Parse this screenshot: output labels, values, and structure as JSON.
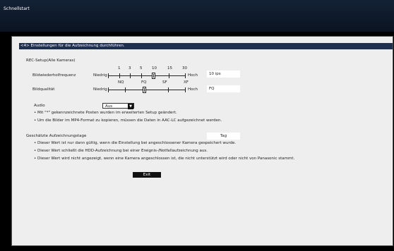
{
  "window": {
    "title": "Schnellstart"
  },
  "header": {
    "text": "<4> Einstellungen für die Aufzeichnung durchführen."
  },
  "rec_setup": {
    "section_label": "REC-Setup(Alle Kameras)",
    "frame_rate": {
      "label": "Bildwiederholfrequenz",
      "min_label": "Niedrig",
      "max_label": "Hoch",
      "ticks": [
        "1",
        "3",
        "5",
        "10",
        "15",
        "30"
      ],
      "value": "10 ips"
    },
    "image_quality": {
      "label": "Bildqualität",
      "min_label": "Niedrig",
      "max_label": "Hoch",
      "ticks": [
        "NQ",
        "FQ",
        "SF",
        "XF"
      ],
      "value": "FQ"
    },
    "audio": {
      "label": "Audio",
      "selected": "Aus"
    },
    "notes": [
      "• Mit \"*\" gekennzeichnete Posten wurden im erweiterten Setup geändert.",
      "• Um die Bilder im MP4-Format zu kopieren, müssen die Daten in AAC-LC aufgezeichnet werden."
    ]
  },
  "estimated": {
    "label": "Geschätzte Aufzeichnungstage",
    "value": "Tag",
    "notes": [
      "• Dieser Wert ist nur dann gültig, wenn die Einstellung bei angeschlossener Kamera gespeichert wurde.",
      "• Dieser Wert schließt die HDD-Aufzeichnung bei einer Ereignis-/Notfallaufzeichnung aus.",
      "• Dieser Wert wird nicht angezeigt, wenn eine Kamera angeschlossen ist, die nicht unterstützt wird oder nicht von Panasonic stammt."
    ]
  },
  "buttons": {
    "exit": "Exit"
  }
}
